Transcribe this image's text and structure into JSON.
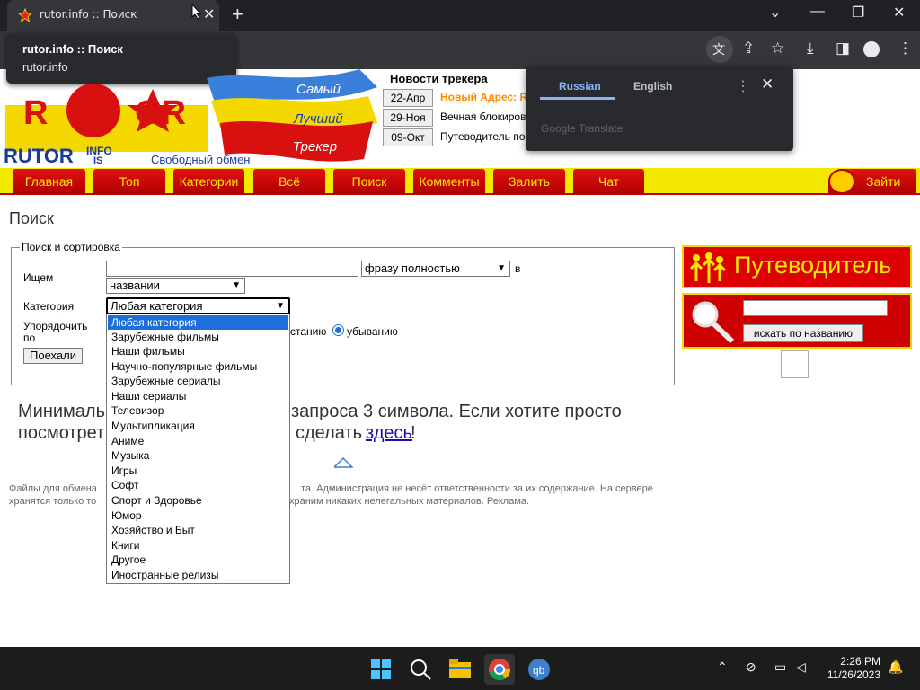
{
  "browser": {
    "tab_title": "rutor.info :: Поиск",
    "tooltip_title": "rutor.info :: Поиск",
    "tooltip_url": "rutor.info"
  },
  "translate": {
    "lang_active": "Russian",
    "lang_other": "English",
    "brand": "Google Translate"
  },
  "logo": {
    "side_words": [
      "Самый",
      "Лучший",
      "Трекер"
    ],
    "brand_word": "RUTOR",
    "brand_sup": "INFO",
    "brand_sub": "IS",
    "slogan": "Свободный обмен"
  },
  "news": {
    "title": "Новости трекера",
    "items": [
      {
        "date": "22-Апр",
        "text": "Новый Адрес: R",
        "color": "#ff8c00"
      },
      {
        "date": "29-Ноя",
        "text": "Вечная блокиров",
        "color": "#000000"
      },
      {
        "date": "09-Окт",
        "text": "Путеводитель по",
        "color": "#000000"
      }
    ]
  },
  "menu": {
    "items": [
      "Главная",
      "Топ",
      "Категории",
      "Всё",
      "Поиск",
      "Комменты",
      "Залить",
      "Чат"
    ],
    "login": "Зайти"
  },
  "search": {
    "page_title": "Поиск",
    "legend": "Поиск и сортировка",
    "label_find": "Ищем",
    "mode_value": "фразу полностью",
    "suffix_in": "в",
    "field_value": "названии",
    "label_category": "Категория",
    "category_value": "Любая категория",
    "label_sort_1": "Упорядочить",
    "label_sort_2": "по",
    "asc_text_tail": "станию",
    "desc_label": "убыванию",
    "go_button": "Поехали"
  },
  "dropdown_options": [
    "Любая категория",
    "Зарубежные фильмы",
    "Наши фильмы",
    "Научно-популярные фильмы",
    "Зарубежные сериалы",
    "Наши сериалы",
    "Телевизор",
    "Мультипликация",
    "Аниме",
    "Музыка",
    "Игры",
    "Софт",
    "Спорт и Здоровье",
    "Юмор",
    "Хозяйство и Быт",
    "Книги",
    "Другое",
    "Иностранные релизы"
  ],
  "message": {
    "part1": "Минималь",
    "part2": "запроса 3 символа. Если хотите просто",
    "part3": "посмотрет",
    "part4": "сделать ",
    "link": "здесь",
    "part5": "!"
  },
  "footer": {
    "line1a": "Файлы для обмена",
    "line1b": "та. Администрация не несёт ответственности за их содержание. На сервере",
    "line2a": "хранятся только то",
    "line2b": "храним никаких нелегальных материалов. Реклама."
  },
  "sidebar": {
    "guide": "Путеводитель",
    "search_button": "искать по названию"
  },
  "taskbar": {
    "time": "2:26 PM",
    "date": "11/26/2023"
  }
}
